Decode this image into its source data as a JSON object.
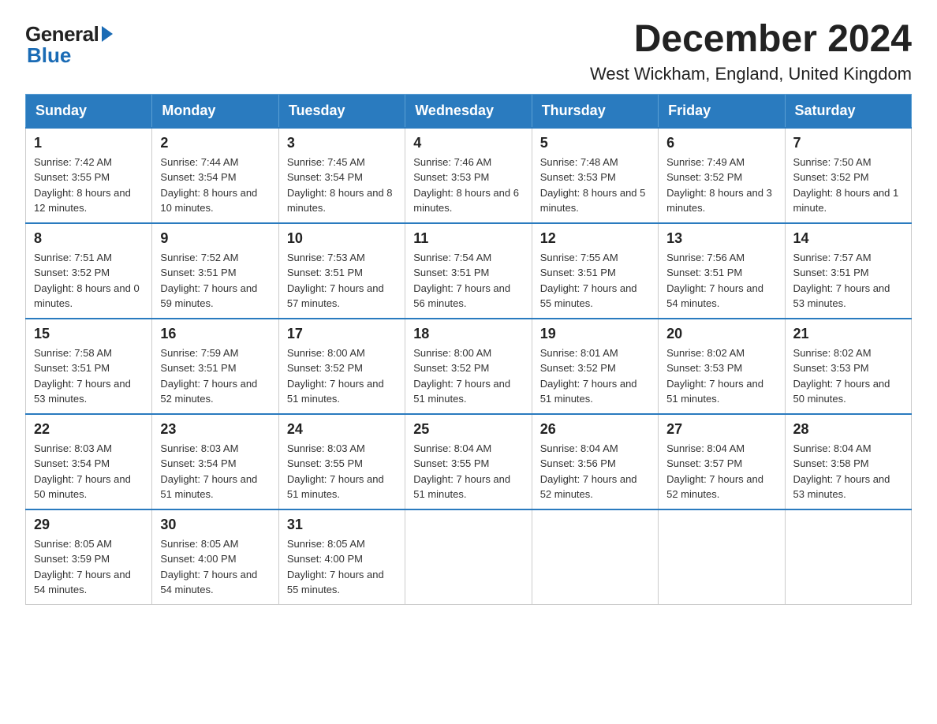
{
  "logo": {
    "general": "General",
    "blue": "Blue"
  },
  "title": "December 2024",
  "subtitle": "West Wickham, England, United Kingdom",
  "days_of_week": [
    "Sunday",
    "Monday",
    "Tuesday",
    "Wednesday",
    "Thursday",
    "Friday",
    "Saturday"
  ],
  "weeks": [
    [
      {
        "day": "1",
        "sunrise": "7:42 AM",
        "sunset": "3:55 PM",
        "daylight": "8 hours and 12 minutes."
      },
      {
        "day": "2",
        "sunrise": "7:44 AM",
        "sunset": "3:54 PM",
        "daylight": "8 hours and 10 minutes."
      },
      {
        "day": "3",
        "sunrise": "7:45 AM",
        "sunset": "3:54 PM",
        "daylight": "8 hours and 8 minutes."
      },
      {
        "day": "4",
        "sunrise": "7:46 AM",
        "sunset": "3:53 PM",
        "daylight": "8 hours and 6 minutes."
      },
      {
        "day": "5",
        "sunrise": "7:48 AM",
        "sunset": "3:53 PM",
        "daylight": "8 hours and 5 minutes."
      },
      {
        "day": "6",
        "sunrise": "7:49 AM",
        "sunset": "3:52 PM",
        "daylight": "8 hours and 3 minutes."
      },
      {
        "day": "7",
        "sunrise": "7:50 AM",
        "sunset": "3:52 PM",
        "daylight": "8 hours and 1 minute."
      }
    ],
    [
      {
        "day": "8",
        "sunrise": "7:51 AM",
        "sunset": "3:52 PM",
        "daylight": "8 hours and 0 minutes."
      },
      {
        "day": "9",
        "sunrise": "7:52 AM",
        "sunset": "3:51 PM",
        "daylight": "7 hours and 59 minutes."
      },
      {
        "day": "10",
        "sunrise": "7:53 AM",
        "sunset": "3:51 PM",
        "daylight": "7 hours and 57 minutes."
      },
      {
        "day": "11",
        "sunrise": "7:54 AM",
        "sunset": "3:51 PM",
        "daylight": "7 hours and 56 minutes."
      },
      {
        "day": "12",
        "sunrise": "7:55 AM",
        "sunset": "3:51 PM",
        "daylight": "7 hours and 55 minutes."
      },
      {
        "day": "13",
        "sunrise": "7:56 AM",
        "sunset": "3:51 PM",
        "daylight": "7 hours and 54 minutes."
      },
      {
        "day": "14",
        "sunrise": "7:57 AM",
        "sunset": "3:51 PM",
        "daylight": "7 hours and 53 minutes."
      }
    ],
    [
      {
        "day": "15",
        "sunrise": "7:58 AM",
        "sunset": "3:51 PM",
        "daylight": "7 hours and 53 minutes."
      },
      {
        "day": "16",
        "sunrise": "7:59 AM",
        "sunset": "3:51 PM",
        "daylight": "7 hours and 52 minutes."
      },
      {
        "day": "17",
        "sunrise": "8:00 AM",
        "sunset": "3:52 PM",
        "daylight": "7 hours and 51 minutes."
      },
      {
        "day": "18",
        "sunrise": "8:00 AM",
        "sunset": "3:52 PM",
        "daylight": "7 hours and 51 minutes."
      },
      {
        "day": "19",
        "sunrise": "8:01 AM",
        "sunset": "3:52 PM",
        "daylight": "7 hours and 51 minutes."
      },
      {
        "day": "20",
        "sunrise": "8:02 AM",
        "sunset": "3:53 PM",
        "daylight": "7 hours and 51 minutes."
      },
      {
        "day": "21",
        "sunrise": "8:02 AM",
        "sunset": "3:53 PM",
        "daylight": "7 hours and 50 minutes."
      }
    ],
    [
      {
        "day": "22",
        "sunrise": "8:03 AM",
        "sunset": "3:54 PM",
        "daylight": "7 hours and 50 minutes."
      },
      {
        "day": "23",
        "sunrise": "8:03 AM",
        "sunset": "3:54 PM",
        "daylight": "7 hours and 51 minutes."
      },
      {
        "day": "24",
        "sunrise": "8:03 AM",
        "sunset": "3:55 PM",
        "daylight": "7 hours and 51 minutes."
      },
      {
        "day": "25",
        "sunrise": "8:04 AM",
        "sunset": "3:55 PM",
        "daylight": "7 hours and 51 minutes."
      },
      {
        "day": "26",
        "sunrise": "8:04 AM",
        "sunset": "3:56 PM",
        "daylight": "7 hours and 52 minutes."
      },
      {
        "day": "27",
        "sunrise": "8:04 AM",
        "sunset": "3:57 PM",
        "daylight": "7 hours and 52 minutes."
      },
      {
        "day": "28",
        "sunrise": "8:04 AM",
        "sunset": "3:58 PM",
        "daylight": "7 hours and 53 minutes."
      }
    ],
    [
      {
        "day": "29",
        "sunrise": "8:05 AM",
        "sunset": "3:59 PM",
        "daylight": "7 hours and 54 minutes."
      },
      {
        "day": "30",
        "sunrise": "8:05 AM",
        "sunset": "4:00 PM",
        "daylight": "7 hours and 54 minutes."
      },
      {
        "day": "31",
        "sunrise": "8:05 AM",
        "sunset": "4:00 PM",
        "daylight": "7 hours and 55 minutes."
      },
      null,
      null,
      null,
      null
    ]
  ],
  "labels": {
    "sunrise": "Sunrise:",
    "sunset": "Sunset:",
    "daylight": "Daylight:"
  }
}
